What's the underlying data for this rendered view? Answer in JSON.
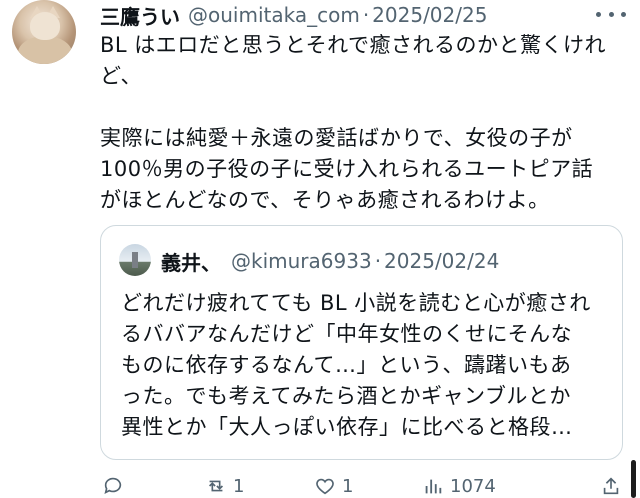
{
  "tweet": {
    "display_name": "三鷹うい",
    "handle": "@ouimitaka_com",
    "separator": "·",
    "date": "2025/02/25",
    "text": "BL はエロだと思うとそれで癒されるのかと驚くけれど、\n\n実際には純愛＋永遠の愛話ばかりで、女役の子が\n100％男の子役の子に受け入れられるユートピア話\nがほとんどなので、そりゃあ癒されるわけよ。"
  },
  "quote": {
    "display_name": "義井、",
    "handle": "@kimura6933",
    "separator": "·",
    "date": "2025/02/24",
    "text": "どれだけ疲れてても BL 小説を読むと心が癒され\nるババアなんだけど「中年女性のくせにそんな\nものに依存するなんて…」という、躊躇いもあ\nった。でも考えてみたら酒とかギャンブルとか\n異性とか「大人っぽい依存」に比べると格段…"
  },
  "actions": {
    "reply": {
      "icon": "reply-icon",
      "count": ""
    },
    "retweet": {
      "icon": "retweet-icon",
      "count": "1"
    },
    "like": {
      "icon": "heart-icon",
      "count": "1"
    },
    "views": {
      "icon": "views-icon",
      "count": "1074"
    },
    "share": {
      "icon": "share-icon",
      "count": ""
    }
  },
  "colors": {
    "text": "#0f1419",
    "secondary": "#536471",
    "border": "#cfd9de"
  }
}
